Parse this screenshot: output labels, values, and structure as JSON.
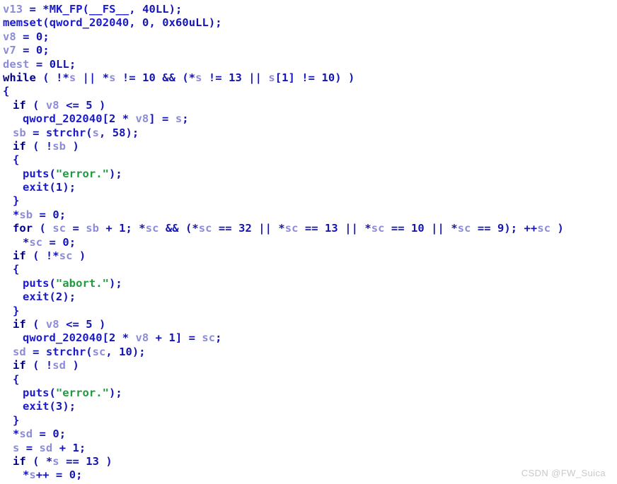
{
  "app": {
    "kind": "decompiler-pseudocode-view",
    "background_color": "#ffffff"
  },
  "theme": {
    "keyword_color": "#00008b",
    "function_color": "#1a1ad0",
    "global_color": "#1a1ad0",
    "variable_color": "#8c8cd9",
    "number_color": "#1515b5",
    "string_color": "#1f9a3f",
    "punctuation_color": "#1515b5",
    "watermark_color": "#c9c9c9"
  },
  "watermark": {
    "text": "CSDN @FW_Suica"
  },
  "code": {
    "language": "c-pseudocode",
    "lines": [
      {
        "indent": 0,
        "tokens": [
          {
            "t": "var",
            "v": "v13"
          },
          {
            "t": "punc",
            "v": " = *"
          },
          {
            "t": "func",
            "v": "MK_FP"
          },
          {
            "t": "punc",
            "v": "("
          },
          {
            "t": "func",
            "v": "__FS__"
          },
          {
            "t": "punc",
            "v": ", "
          },
          {
            "t": "num",
            "v": "40LL"
          },
          {
            "t": "punc",
            "v": ");"
          }
        ]
      },
      {
        "indent": 0,
        "tokens": [
          {
            "t": "func",
            "v": "memset"
          },
          {
            "t": "punc",
            "v": "("
          },
          {
            "t": "global",
            "v": "qword_202040"
          },
          {
            "t": "punc",
            "v": ", "
          },
          {
            "t": "num",
            "v": "0"
          },
          {
            "t": "punc",
            "v": ", "
          },
          {
            "t": "num",
            "v": "0x60uLL"
          },
          {
            "t": "punc",
            "v": ");"
          }
        ]
      },
      {
        "indent": 0,
        "tokens": [
          {
            "t": "var",
            "v": "v8"
          },
          {
            "t": "punc",
            "v": " = "
          },
          {
            "t": "num",
            "v": "0"
          },
          {
            "t": "punc",
            "v": ";"
          }
        ]
      },
      {
        "indent": 0,
        "tokens": [
          {
            "t": "var",
            "v": "v7"
          },
          {
            "t": "punc",
            "v": " = "
          },
          {
            "t": "num",
            "v": "0"
          },
          {
            "t": "punc",
            "v": ";"
          }
        ]
      },
      {
        "indent": 0,
        "tokens": [
          {
            "t": "var",
            "v": "dest"
          },
          {
            "t": "punc",
            "v": " = "
          },
          {
            "t": "num",
            "v": "0LL"
          },
          {
            "t": "punc",
            "v": ";"
          }
        ]
      },
      {
        "indent": 0,
        "tokens": [
          {
            "t": "keyword",
            "v": "while"
          },
          {
            "t": "punc",
            "v": " ( !*"
          },
          {
            "t": "var",
            "v": "s"
          },
          {
            "t": "punc",
            "v": " || *"
          },
          {
            "t": "var",
            "v": "s"
          },
          {
            "t": "punc",
            "v": " != "
          },
          {
            "t": "num",
            "v": "10"
          },
          {
            "t": "punc",
            "v": " && (*"
          },
          {
            "t": "var",
            "v": "s"
          },
          {
            "t": "punc",
            "v": " != "
          },
          {
            "t": "num",
            "v": "13"
          },
          {
            "t": "punc",
            "v": " || "
          },
          {
            "t": "var",
            "v": "s"
          },
          {
            "t": "punc",
            "v": "["
          },
          {
            "t": "num",
            "v": "1"
          },
          {
            "t": "punc",
            "v": "] != "
          },
          {
            "t": "num",
            "v": "10"
          },
          {
            "t": "punc",
            "v": ") )"
          }
        ]
      },
      {
        "indent": 0,
        "tokens": [
          {
            "t": "punc",
            "v": "{"
          }
        ]
      },
      {
        "indent": 1,
        "tokens": [
          {
            "t": "keyword",
            "v": "if"
          },
          {
            "t": "punc",
            "v": " ( "
          },
          {
            "t": "var",
            "v": "v8"
          },
          {
            "t": "punc",
            "v": " <= "
          },
          {
            "t": "num",
            "v": "5"
          },
          {
            "t": "punc",
            "v": " )"
          }
        ]
      },
      {
        "indent": 2,
        "tokens": [
          {
            "t": "global",
            "v": "qword_202040"
          },
          {
            "t": "punc",
            "v": "["
          },
          {
            "t": "num",
            "v": "2"
          },
          {
            "t": "punc",
            "v": " * "
          },
          {
            "t": "var",
            "v": "v8"
          },
          {
            "t": "punc",
            "v": "] = "
          },
          {
            "t": "var",
            "v": "s"
          },
          {
            "t": "punc",
            "v": ";"
          }
        ]
      },
      {
        "indent": 1,
        "tokens": [
          {
            "t": "var",
            "v": "sb"
          },
          {
            "t": "punc",
            "v": " = "
          },
          {
            "t": "func",
            "v": "strchr"
          },
          {
            "t": "punc",
            "v": "("
          },
          {
            "t": "var",
            "v": "s"
          },
          {
            "t": "punc",
            "v": ", "
          },
          {
            "t": "num",
            "v": "58"
          },
          {
            "t": "punc",
            "v": ");"
          }
        ]
      },
      {
        "indent": 1,
        "tokens": [
          {
            "t": "keyword",
            "v": "if"
          },
          {
            "t": "punc",
            "v": " ( !"
          },
          {
            "t": "var",
            "v": "sb"
          },
          {
            "t": "punc",
            "v": " )"
          }
        ]
      },
      {
        "indent": 1,
        "tokens": [
          {
            "t": "punc",
            "v": "{"
          }
        ]
      },
      {
        "indent": 2,
        "tokens": [
          {
            "t": "func",
            "v": "puts"
          },
          {
            "t": "punc",
            "v": "("
          },
          {
            "t": "str",
            "v": "\"error.\""
          },
          {
            "t": "punc",
            "v": ");"
          }
        ]
      },
      {
        "indent": 2,
        "tokens": [
          {
            "t": "func",
            "v": "exit"
          },
          {
            "t": "punc",
            "v": "("
          },
          {
            "t": "num",
            "v": "1"
          },
          {
            "t": "punc",
            "v": ");"
          }
        ]
      },
      {
        "indent": 1,
        "tokens": [
          {
            "t": "punc",
            "v": "}"
          }
        ]
      },
      {
        "indent": 1,
        "tokens": [
          {
            "t": "punc",
            "v": "*"
          },
          {
            "t": "var",
            "v": "sb"
          },
          {
            "t": "punc",
            "v": " = "
          },
          {
            "t": "num",
            "v": "0"
          },
          {
            "t": "punc",
            "v": ";"
          }
        ]
      },
      {
        "indent": 1,
        "tokens": [
          {
            "t": "keyword",
            "v": "for"
          },
          {
            "t": "punc",
            "v": " ( "
          },
          {
            "t": "var",
            "v": "sc"
          },
          {
            "t": "punc",
            "v": " = "
          },
          {
            "t": "var",
            "v": "sb"
          },
          {
            "t": "punc",
            "v": " + "
          },
          {
            "t": "num",
            "v": "1"
          },
          {
            "t": "punc",
            "v": "; *"
          },
          {
            "t": "var",
            "v": "sc"
          },
          {
            "t": "punc",
            "v": " && (*"
          },
          {
            "t": "var",
            "v": "sc"
          },
          {
            "t": "punc",
            "v": " == "
          },
          {
            "t": "num",
            "v": "32"
          },
          {
            "t": "punc",
            "v": " || *"
          },
          {
            "t": "var",
            "v": "sc"
          },
          {
            "t": "punc",
            "v": " == "
          },
          {
            "t": "num",
            "v": "13"
          },
          {
            "t": "punc",
            "v": " || *"
          },
          {
            "t": "var",
            "v": "sc"
          },
          {
            "t": "punc",
            "v": " == "
          },
          {
            "t": "num",
            "v": "10"
          },
          {
            "t": "punc",
            "v": " || *"
          },
          {
            "t": "var",
            "v": "sc"
          },
          {
            "t": "punc",
            "v": " == "
          },
          {
            "t": "num",
            "v": "9"
          },
          {
            "t": "punc",
            "v": "); ++"
          },
          {
            "t": "var",
            "v": "sc"
          },
          {
            "t": "punc",
            "v": " )"
          }
        ]
      },
      {
        "indent": 2,
        "tokens": [
          {
            "t": "punc",
            "v": "*"
          },
          {
            "t": "var",
            "v": "sc"
          },
          {
            "t": "punc",
            "v": " = "
          },
          {
            "t": "num",
            "v": "0"
          },
          {
            "t": "punc",
            "v": ";"
          }
        ]
      },
      {
        "indent": 1,
        "tokens": [
          {
            "t": "keyword",
            "v": "if"
          },
          {
            "t": "punc",
            "v": " ( !*"
          },
          {
            "t": "var",
            "v": "sc"
          },
          {
            "t": "punc",
            "v": " )"
          }
        ]
      },
      {
        "indent": 1,
        "tokens": [
          {
            "t": "punc",
            "v": "{"
          }
        ]
      },
      {
        "indent": 2,
        "tokens": [
          {
            "t": "func",
            "v": "puts"
          },
          {
            "t": "punc",
            "v": "("
          },
          {
            "t": "str",
            "v": "\"abort.\""
          },
          {
            "t": "punc",
            "v": ");"
          }
        ]
      },
      {
        "indent": 2,
        "tokens": [
          {
            "t": "func",
            "v": "exit"
          },
          {
            "t": "punc",
            "v": "("
          },
          {
            "t": "num",
            "v": "2"
          },
          {
            "t": "punc",
            "v": ");"
          }
        ]
      },
      {
        "indent": 1,
        "tokens": [
          {
            "t": "punc",
            "v": "}"
          }
        ]
      },
      {
        "indent": 1,
        "tokens": [
          {
            "t": "keyword",
            "v": "if"
          },
          {
            "t": "punc",
            "v": " ( "
          },
          {
            "t": "var",
            "v": "v8"
          },
          {
            "t": "punc",
            "v": " <= "
          },
          {
            "t": "num",
            "v": "5"
          },
          {
            "t": "punc",
            "v": " )"
          }
        ]
      },
      {
        "indent": 2,
        "tokens": [
          {
            "t": "global",
            "v": "qword_202040"
          },
          {
            "t": "punc",
            "v": "["
          },
          {
            "t": "num",
            "v": "2"
          },
          {
            "t": "punc",
            "v": " * "
          },
          {
            "t": "var",
            "v": "v8"
          },
          {
            "t": "punc",
            "v": " + "
          },
          {
            "t": "num",
            "v": "1"
          },
          {
            "t": "punc",
            "v": "] = "
          },
          {
            "t": "var",
            "v": "sc"
          },
          {
            "t": "punc",
            "v": ";"
          }
        ]
      },
      {
        "indent": 1,
        "tokens": [
          {
            "t": "var",
            "v": "sd"
          },
          {
            "t": "punc",
            "v": " = "
          },
          {
            "t": "func",
            "v": "strchr"
          },
          {
            "t": "punc",
            "v": "("
          },
          {
            "t": "var",
            "v": "sc"
          },
          {
            "t": "punc",
            "v": ", "
          },
          {
            "t": "num",
            "v": "10"
          },
          {
            "t": "punc",
            "v": ");"
          }
        ]
      },
      {
        "indent": 1,
        "tokens": [
          {
            "t": "keyword",
            "v": "if"
          },
          {
            "t": "punc",
            "v": " ( !"
          },
          {
            "t": "var",
            "v": "sd"
          },
          {
            "t": "punc",
            "v": " )"
          }
        ]
      },
      {
        "indent": 1,
        "tokens": [
          {
            "t": "punc",
            "v": "{"
          }
        ]
      },
      {
        "indent": 2,
        "tokens": [
          {
            "t": "func",
            "v": "puts"
          },
          {
            "t": "punc",
            "v": "("
          },
          {
            "t": "str",
            "v": "\"error.\""
          },
          {
            "t": "punc",
            "v": ");"
          }
        ]
      },
      {
        "indent": 2,
        "tokens": [
          {
            "t": "func",
            "v": "exit"
          },
          {
            "t": "punc",
            "v": "("
          },
          {
            "t": "num",
            "v": "3"
          },
          {
            "t": "punc",
            "v": ");"
          }
        ]
      },
      {
        "indent": 1,
        "tokens": [
          {
            "t": "punc",
            "v": "}"
          }
        ]
      },
      {
        "indent": 1,
        "tokens": [
          {
            "t": "punc",
            "v": "*"
          },
          {
            "t": "var",
            "v": "sd"
          },
          {
            "t": "punc",
            "v": " = "
          },
          {
            "t": "num",
            "v": "0"
          },
          {
            "t": "punc",
            "v": ";"
          }
        ]
      },
      {
        "indent": 1,
        "tokens": [
          {
            "t": "var",
            "v": "s"
          },
          {
            "t": "punc",
            "v": " = "
          },
          {
            "t": "var",
            "v": "sd"
          },
          {
            "t": "punc",
            "v": " + "
          },
          {
            "t": "num",
            "v": "1"
          },
          {
            "t": "punc",
            "v": ";"
          }
        ]
      },
      {
        "indent": 1,
        "tokens": [
          {
            "t": "keyword",
            "v": "if"
          },
          {
            "t": "punc",
            "v": " ( *"
          },
          {
            "t": "var",
            "v": "s"
          },
          {
            "t": "punc",
            "v": " == "
          },
          {
            "t": "num",
            "v": "13"
          },
          {
            "t": "punc",
            "v": " )"
          }
        ]
      },
      {
        "indent": 2,
        "tokens": [
          {
            "t": "punc",
            "v": "*"
          },
          {
            "t": "var",
            "v": "s"
          },
          {
            "t": "punc",
            "v": "++ = "
          },
          {
            "t": "num",
            "v": "0"
          },
          {
            "t": "punc",
            "v": ";"
          }
        ]
      }
    ]
  }
}
